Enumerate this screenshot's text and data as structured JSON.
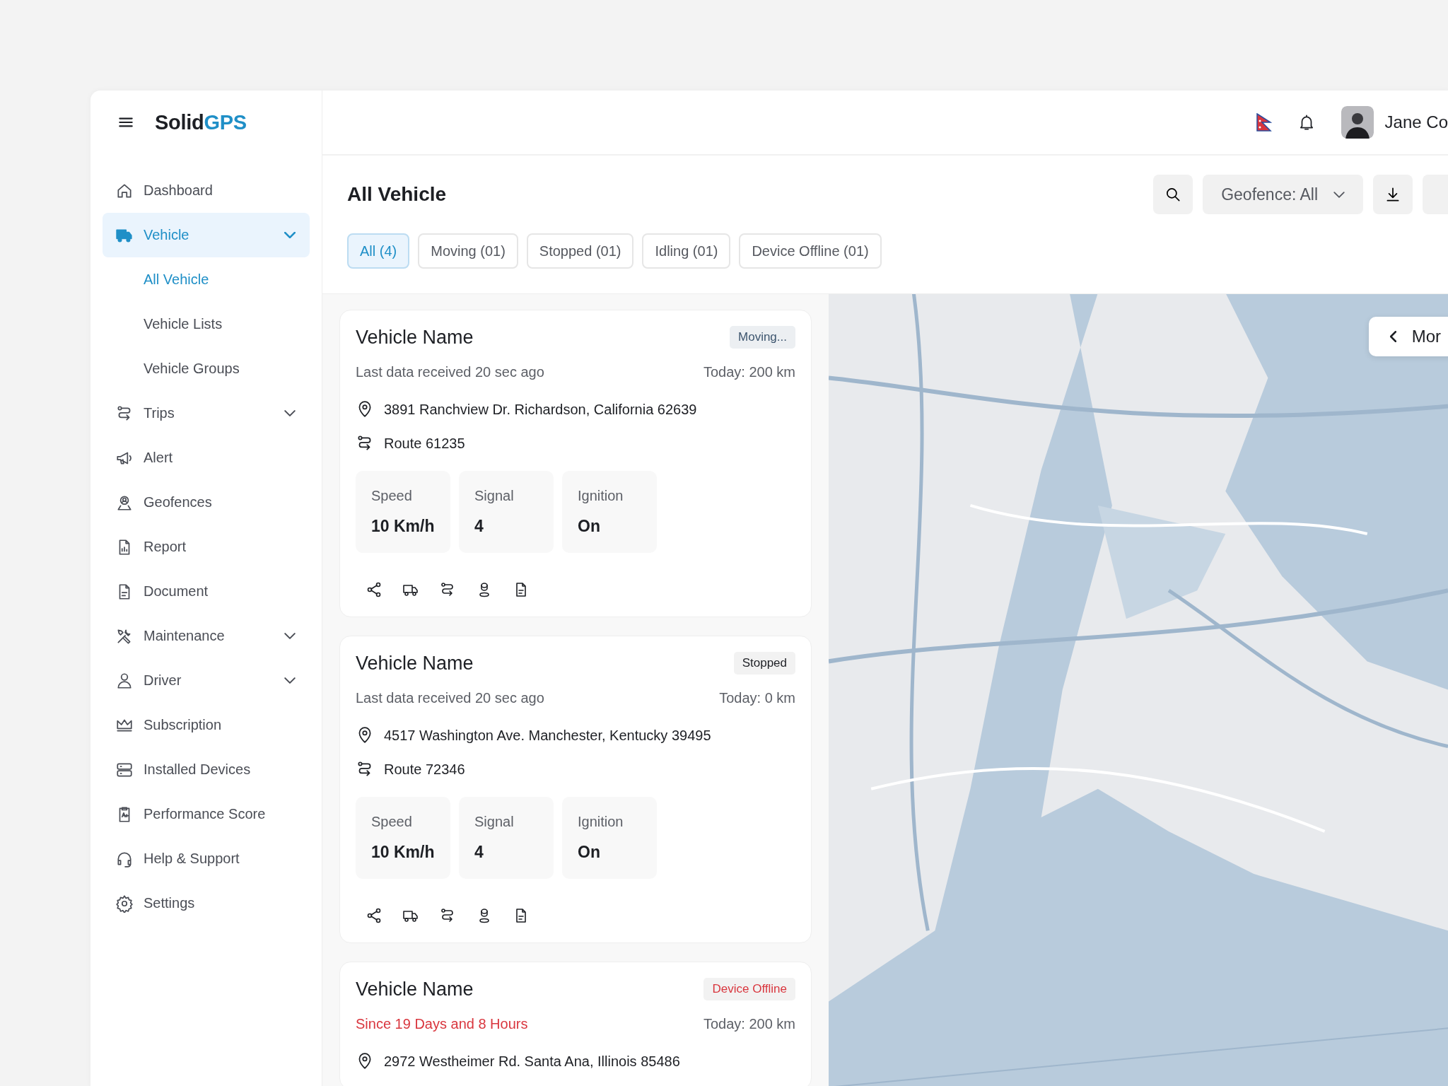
{
  "sidebar": {
    "logo": {
      "part_1": "Solid",
      "part_2": "GPS"
    },
    "items": [
      {
        "label": "Dashboard",
        "selected": false
      },
      {
        "label": "Vehicle",
        "selected": true,
        "expanded": true,
        "children": [
          {
            "label": "All Vehicle",
            "selected": true
          },
          {
            "label": "Vehicle Lists",
            "selected": false
          },
          {
            "label": "Vehicle Groups",
            "selected": false
          }
        ]
      },
      {
        "label": "Trips",
        "selected": false,
        "expanded": false
      },
      {
        "label": "Alert",
        "selected": false
      },
      {
        "label": "Geofences",
        "selected": false
      },
      {
        "label": "Report",
        "selected": false
      },
      {
        "label": "Document",
        "selected": false
      },
      {
        "label": "Maintenance",
        "selected": false,
        "expanded": false
      },
      {
        "label": "Driver",
        "selected": false,
        "expanded": false
      },
      {
        "label": "Subscription",
        "selected": false
      },
      {
        "label": "Installed Devices",
        "selected": false
      },
      {
        "label": "Performance Score",
        "selected": false
      },
      {
        "label": "Help & Support",
        "selected": false
      },
      {
        "label": "Settings",
        "selected": false
      }
    ]
  },
  "header": {
    "user_name": "Jane Co"
  },
  "page": {
    "title": "All Vehicle",
    "geofence_filter": "Geofence: All",
    "tabs": [
      {
        "label": "All (4)",
        "selected": true
      },
      {
        "label": "Moving (01)",
        "selected": false
      },
      {
        "label": "Stopped (01)",
        "selected": false
      },
      {
        "label": "Idling (01)",
        "selected": false
      },
      {
        "label": "Device Offline (01)",
        "selected": false
      }
    ]
  },
  "vehicles": [
    {
      "name": "Vehicle Name",
      "status": {
        "label": "Moving...",
        "kind": "moving"
      },
      "last_data": "Last data received 20 sec ago",
      "today": "Today: 200 km",
      "address": "3891 Ranchview Dr. Richardson, California 62639",
      "route": "Route 61235",
      "stats": [
        {
          "label": "Speed",
          "value": "10 Km/h"
        },
        {
          "label": "Signal",
          "value": "4"
        },
        {
          "label": "Ignition",
          "value": "On"
        }
      ]
    },
    {
      "name": "Vehicle Name",
      "status": {
        "label": "Stopped",
        "kind": "stopped"
      },
      "last_data": "Last data received 20 sec ago",
      "today": "Today: 0 km",
      "address": "4517 Washington Ave. Manchester, Kentucky 39495",
      "route": "Route 72346",
      "stats": [
        {
          "label": "Speed",
          "value": "10 Km/h"
        },
        {
          "label": "Signal",
          "value": "4"
        },
        {
          "label": "Ignition",
          "value": "On"
        }
      ]
    },
    {
      "name": "Vehicle Name",
      "status": {
        "label": "Device Offline",
        "kind": "offline"
      },
      "last_data": "Since 19 Days and 8 Hours",
      "today": "Today: 200 km",
      "address": "2972 Westheimer Rd. Santa Ana, Illinois 85486"
    }
  ],
  "map": {
    "more_button": "Mor"
  }
}
